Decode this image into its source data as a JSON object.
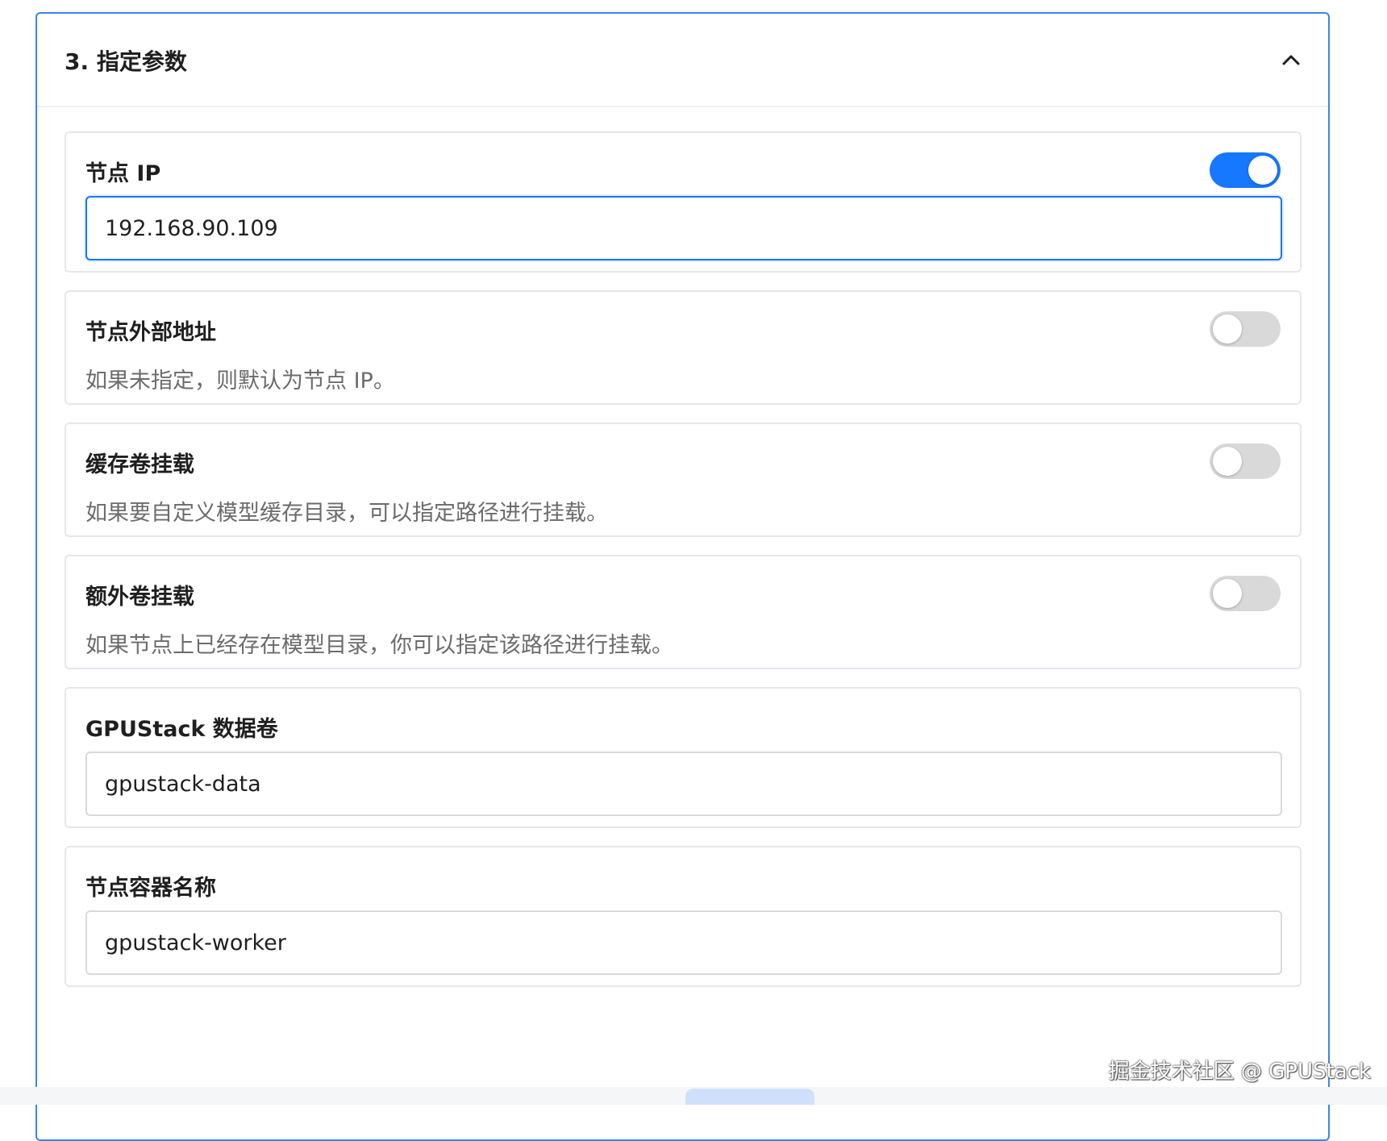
{
  "section": {
    "title": "3. 指定参数",
    "collapse_icon": "chevron-up-icon"
  },
  "fields": {
    "node_ip": {
      "label": "节点 IP",
      "toggle_on": true,
      "value": "192.168.90.109"
    },
    "node_external_address": {
      "label": "节点外部地址",
      "toggle_on": false,
      "description": "如果未指定，则默认为节点 IP。"
    },
    "cache_volume_mount": {
      "label": "缓存卷挂载",
      "toggle_on": false,
      "description": "如果要自定义模型缓存目录，可以指定路径进行挂载。"
    },
    "extra_volume_mount": {
      "label": "额外卷挂载",
      "toggle_on": false,
      "description": "如果节点上已经存在模型目录，你可以指定该路径进行挂载。"
    },
    "gpustack_data_volume": {
      "label": "GPUStack 数据卷",
      "value": "gpustack-data"
    },
    "node_container_name": {
      "label": "节点容器名称",
      "value": "gpustack-worker"
    }
  },
  "colors": {
    "accent": "#1677ff",
    "panel_border": "#3b86e8",
    "toggle_off": "#d9d9d9",
    "description_text": "#6b6b6b"
  },
  "watermark": "掘金技术社区 @ GPUStack"
}
